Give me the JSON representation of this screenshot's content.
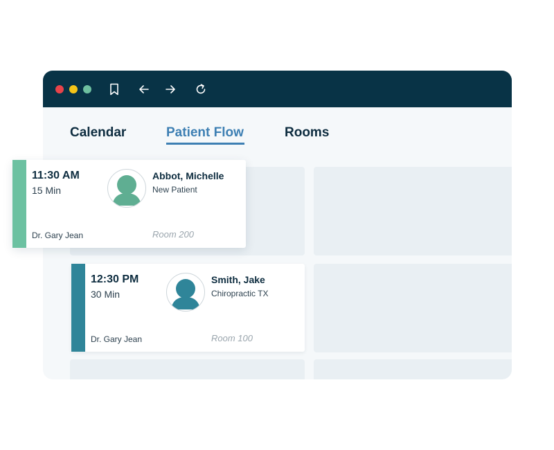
{
  "window": {
    "controls": {
      "close_color": "#e8434a",
      "minimize_color": "#f5c518",
      "maximize_color": "#6ec0a0"
    },
    "toolbar_icons": [
      "bookmark-icon",
      "back-arrow-icon",
      "forward-arrow-icon",
      "refresh-icon"
    ],
    "titlebar_color": "#083346"
  },
  "tabs": [
    {
      "label": "Calendar",
      "active": false
    },
    {
      "label": "Patient Flow",
      "active": true
    },
    {
      "label": "Rooms",
      "active": false
    }
  ],
  "accent_color": "#3d7fb3",
  "appointments": [
    {
      "time": "11:30 AM",
      "duration": "15 Min",
      "patient": "Abbot, Michelle",
      "type": "New Patient",
      "doctor": "Dr. Gary Jean",
      "room": "Room 200",
      "color": "#6cc1a1"
    },
    {
      "time": "12:30 PM",
      "duration": "30 Min",
      "patient": "Smith, Jake",
      "type": "Chiropractic TX",
      "doctor": "Dr. Gary Jean",
      "room": "Room 100",
      "color": "#2f8599"
    }
  ]
}
